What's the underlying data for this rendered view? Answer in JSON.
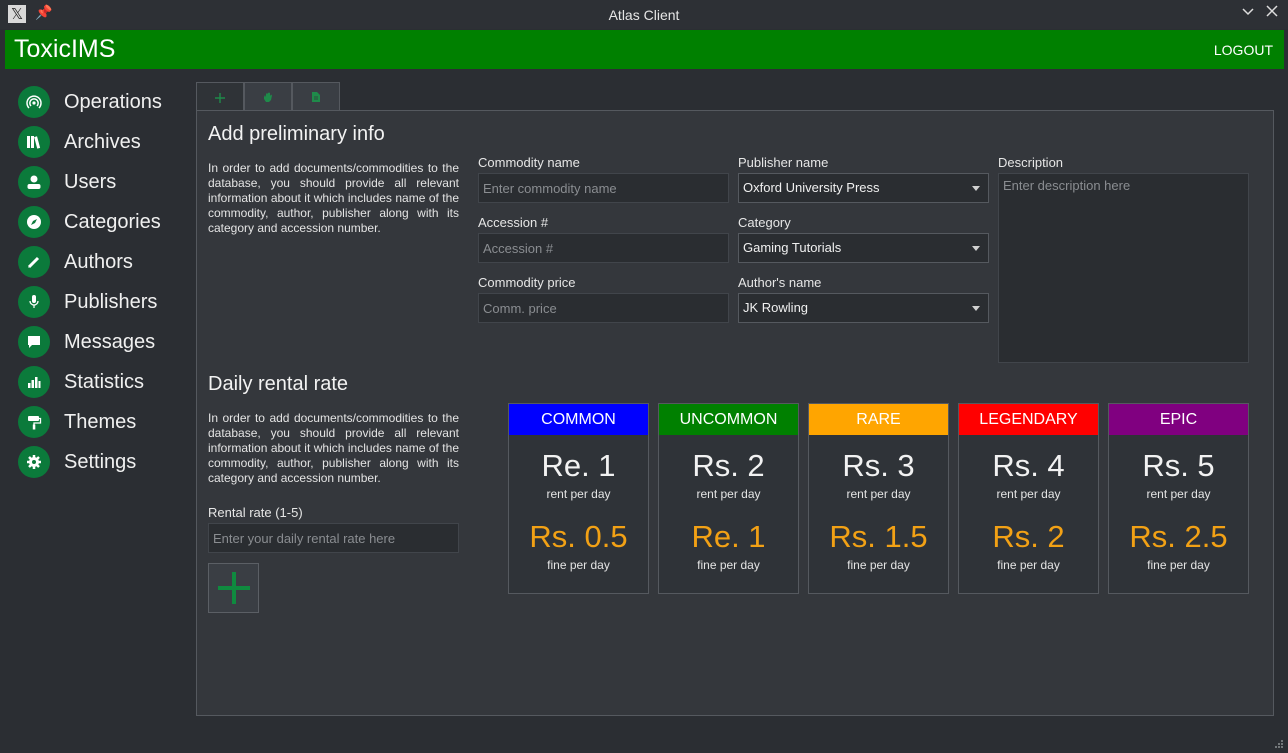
{
  "window": {
    "title": "Atlas Client",
    "app_icon": "x-logo-icon",
    "pin_icon": "pin-icon",
    "minimize_icon": "chevron-down-icon",
    "close_icon": "close-icon"
  },
  "appbar": {
    "brand": "ToxicIMS",
    "logout_label": "LOGOUT",
    "color": "#008000"
  },
  "sidebar": {
    "icon_bg": "#0b7a3b",
    "items": [
      {
        "label": "Operations",
        "icon": "signal-icon"
      },
      {
        "label": "Archives",
        "icon": "books-icon"
      },
      {
        "label": "Users",
        "icon": "user-icon"
      },
      {
        "label": "Categories",
        "icon": "compass-icon"
      },
      {
        "label": "Authors",
        "icon": "pen-icon"
      },
      {
        "label": "Publishers",
        "icon": "microphone-icon"
      },
      {
        "label": "Messages",
        "icon": "chat-bubble-icon"
      },
      {
        "label": "Statistics",
        "icon": "bar-chart-icon"
      },
      {
        "label": "Themes",
        "icon": "paint-roller-icon"
      },
      {
        "label": "Settings",
        "icon": "gear-icon"
      }
    ]
  },
  "tabs": [
    {
      "icon": "plus-icon",
      "active": true
    },
    {
      "icon": "hand-icon",
      "active": false
    },
    {
      "icon": "document-icon",
      "active": false
    }
  ],
  "prelim": {
    "title": "Add preliminary info",
    "description": "In order to add documents/commodities to the database, you should provide all relevant information about it which includes name of the commodity, author, publisher along with its category and accession number.",
    "commodity_name_label": "Commodity name",
    "commodity_name_placeholder": "Enter commodity name",
    "accession_label": "Accession #",
    "accession_placeholder": "Accession #",
    "price_label": "Commodity price",
    "price_placeholder": "Comm. price",
    "publisher_label": "Publisher name",
    "publisher_value": "Oxford University Press",
    "category_label": "Category",
    "category_value": "Gaming Tutorials",
    "author_label": "Author's name",
    "author_value": "JK Rowling",
    "description_label": "Description",
    "description_placeholder": "Enter description here"
  },
  "rental": {
    "title": "Daily rental rate",
    "description": "In order to add documents/commodities to the database, you should provide all relevant information about it which includes name of the commodity, author, publisher along with its category and accession number.",
    "rate_label": "Rental rate (1-5)",
    "rate_placeholder": "Enter your daily rental rate here",
    "add_icon": "plus-icon",
    "tiers": [
      {
        "name": "COMMON",
        "color": "#0000ff",
        "rent": "Re. 1",
        "rent_unit": "rent per day",
        "fine": "Rs. 0.5",
        "fine_unit": "fine per day"
      },
      {
        "name": "UNCOMMON",
        "color": "#008000",
        "rent": "Rs. 2",
        "rent_unit": "rent per day",
        "fine": "Re. 1",
        "fine_unit": "fine per day"
      },
      {
        "name": "RARE",
        "color": "#ffa500",
        "rent": "Rs. 3",
        "rent_unit": "rent per day",
        "fine": "Rs. 1.5",
        "fine_unit": "fine per day"
      },
      {
        "name": "LEGENDARY",
        "color": "#ff0000",
        "rent": "Rs. 4",
        "rent_unit": "rent per day",
        "fine": "Rs. 2",
        "fine_unit": "fine per day"
      },
      {
        "name": "EPIC",
        "color": "#800080",
        "rent": "Rs. 5",
        "rent_unit": "rent per day",
        "fine": "Rs. 2.5",
        "fine_unit": "fine per day"
      }
    ]
  }
}
